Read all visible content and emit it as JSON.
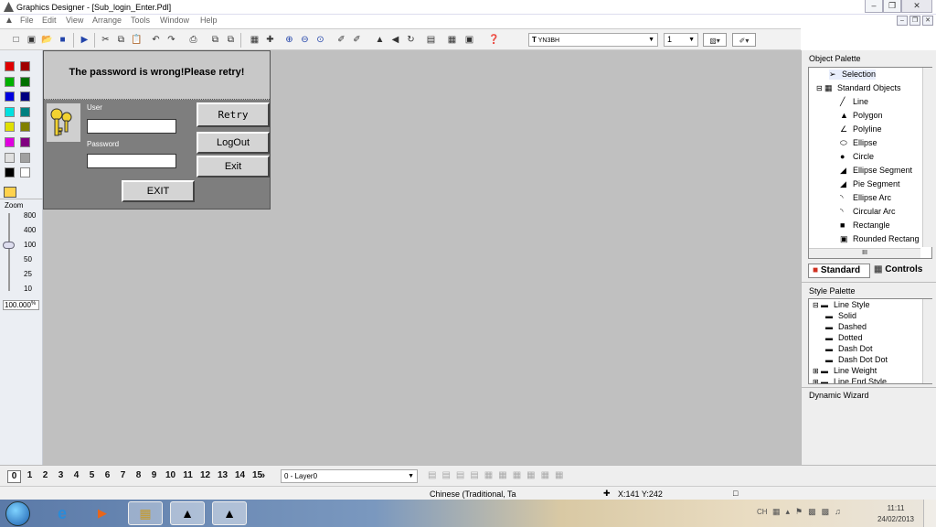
{
  "window": {
    "title": "Graphics Designer - [Sub_login_Enter.Pdl]"
  },
  "menu": [
    "File",
    "Edit",
    "View",
    "Arrange",
    "Tools",
    "Window",
    "Help"
  ],
  "toolbar": {
    "font_combo": "YN3BH",
    "linewidth_value": "1"
  },
  "left_palette": {
    "colors": [
      "#e00000",
      "#a00000",
      "#00b000",
      "#007000",
      "#0000e0",
      "#000080",
      "#00e0e0",
      "#008080",
      "#e0e000",
      "#808000",
      "#e000e0",
      "#800080",
      "#e0e0e0",
      "#a0a0a0",
      "#000000",
      "#ffffff"
    ],
    "zoom_label": "Zoom",
    "zoom_levels": [
      "800",
      "400",
      "100",
      "50",
      "25",
      "10"
    ],
    "zoom_value": "100.000",
    "zoom_unit": "%"
  },
  "dialog": {
    "message": "The password is wrong!Please retry!",
    "user_label": "User",
    "password_label": "Password",
    "user_value": "",
    "password_value": "",
    "retry_label": "Retry",
    "logout_label": "LogOut",
    "exit_label": "Exit",
    "exit_big_label": "EXIT"
  },
  "object_palette": {
    "title": "Object Palette",
    "items": [
      {
        "label": "Selection"
      },
      {
        "label": "Standard Objects"
      },
      {
        "label": "Line"
      },
      {
        "label": "Polygon"
      },
      {
        "label": "Polyline"
      },
      {
        "label": "Ellipse"
      },
      {
        "label": "Circle"
      },
      {
        "label": "Ellipse Segment"
      },
      {
        "label": "Pie Segment"
      },
      {
        "label": "Ellipse Arc"
      },
      {
        "label": "Circular Arc"
      },
      {
        "label": "Rectangle"
      },
      {
        "label": "Rounded Rectang"
      }
    ],
    "scroll_label": "III",
    "tab_standard": "Standard",
    "tab_controls": "Controls"
  },
  "style_palette": {
    "title": "Style Palette",
    "items": [
      {
        "label": "Line Style"
      },
      {
        "label": "Solid"
      },
      {
        "label": "Dashed"
      },
      {
        "label": "Dotted"
      },
      {
        "label": "Dash Dot"
      },
      {
        "label": "Dash Dot Dot"
      },
      {
        "label": "Line Weight"
      },
      {
        "label": "Line End Style"
      }
    ]
  },
  "dynamic_wizard": {
    "title": "Dynamic Wizard"
  },
  "pages": [
    "0",
    "1",
    "2",
    "3",
    "4",
    "5",
    "6",
    "7",
    "8",
    "9",
    "10",
    "11",
    "12",
    "13",
    "14",
    "15"
  ],
  "layer_combo": "0 - Layer0",
  "status": {
    "language": "Chinese (Traditional, Ta",
    "coords": "X:141 Y:242"
  },
  "taskbar": {
    "lang": "CH",
    "time": "11:11",
    "date": "24/02/2013"
  }
}
